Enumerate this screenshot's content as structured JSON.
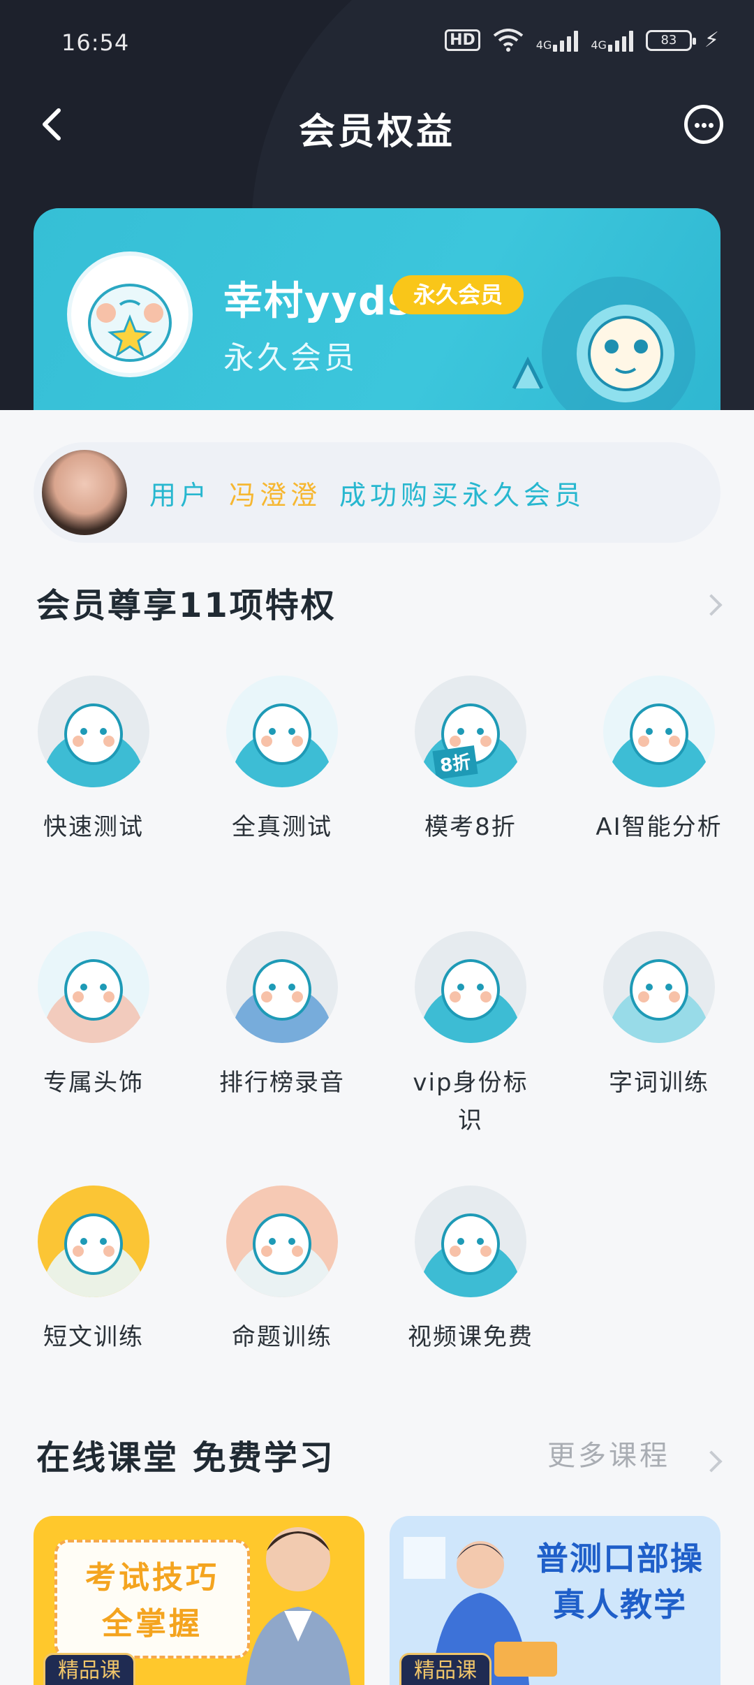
{
  "status_bar": {
    "time": "16:54",
    "network_1": "4G",
    "network_2": "4G",
    "battery": "83",
    "hd": "HD"
  },
  "nav": {
    "title": "会员权益"
  },
  "profile": {
    "username": "幸村yyds",
    "badge": "永久会员",
    "subtitle": "永久会员"
  },
  "ticker": {
    "prefix": "用户",
    "name": "冯澄澄",
    "suffix": "成功购买永久会员"
  },
  "privileges": {
    "title": "会员尊享11项特权",
    "items": [
      {
        "label": "快速测试",
        "icon": "quick-test-icon"
      },
      {
        "label": "全真测试",
        "icon": "full-test-icon"
      },
      {
        "label": "模考8折",
        "icon": "mock-exam-discount-icon",
        "discount": "8折"
      },
      {
        "label": "AI智能分析",
        "icon": "ai-analysis-icon"
      },
      {
        "label": "专属头饰",
        "icon": "exclusive-headwear-icon"
      },
      {
        "label": "排行榜录音",
        "icon": "leaderboard-recording-icon"
      },
      {
        "label": "vip身份标识",
        "icon": "vip-badge-icon"
      },
      {
        "label": "字词训练",
        "icon": "word-training-icon"
      },
      {
        "label": "短文训练",
        "icon": "passage-training-icon"
      },
      {
        "label": "命题训练",
        "icon": "topic-training-icon"
      },
      {
        "label": "视频课免费",
        "icon": "free-video-course-icon"
      }
    ]
  },
  "courses": {
    "title": "在线课堂 免费学习",
    "more": "更多课程",
    "cards": [
      {
        "title_line1": "考试技巧",
        "title_line2": "全掌握",
        "tag": "精品课"
      },
      {
        "title_line1": "普测口部操",
        "title_line2": "真人教学",
        "tag": "精品课"
      }
    ]
  },
  "colors": {
    "header_bg": "#1d212c",
    "accent": "#36bfd6",
    "gold": "#f9c619",
    "ticker_name": "#f6b731"
  }
}
